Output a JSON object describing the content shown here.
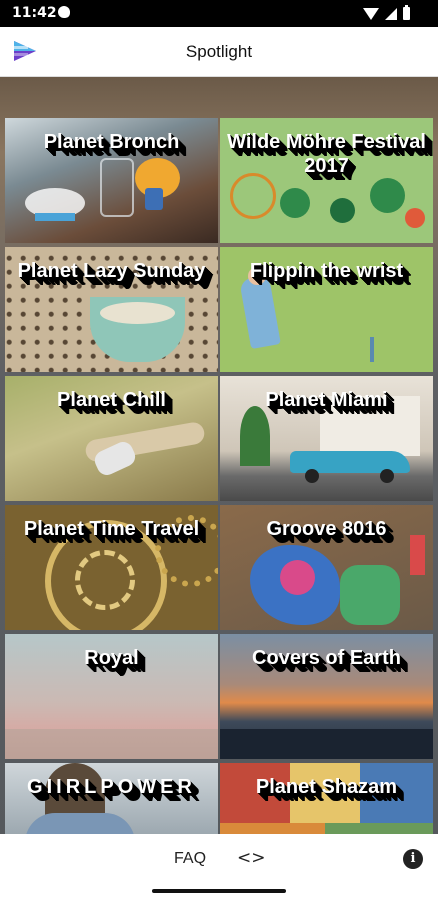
{
  "status": {
    "time": "11:42"
  },
  "app": {
    "title": "Spotlight"
  },
  "tiles": [
    {
      "label": "Planet Bronch"
    },
    {
      "label": "Wilde Möhre Festival 2017"
    },
    {
      "label": "Planet Lazy Sunday"
    },
    {
      "label": "Flippin the wrist"
    },
    {
      "label": "Planet Chill"
    },
    {
      "label": "Planet Miami"
    },
    {
      "label": "Planet Time Travel"
    },
    {
      "label": "Groove 8016"
    },
    {
      "label": "Royal"
    },
    {
      "label": "Covers of Earth"
    },
    {
      "label": "GIIRLPOWER"
    },
    {
      "label": "Planet Shazam"
    }
  ],
  "bottom": {
    "faq": "FAQ",
    "code_icon": "code-icon",
    "info_icon": "info-icon"
  },
  "colors": {
    "appbar": "#ffffff",
    "status": "#000000"
  }
}
